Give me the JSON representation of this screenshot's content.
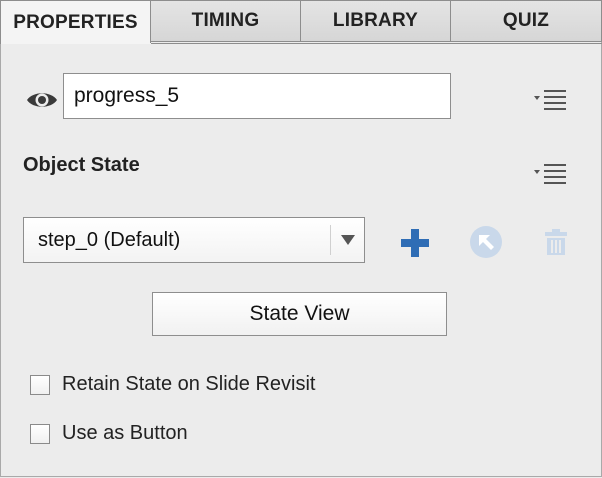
{
  "tabs": [
    {
      "label": "PROPERTIES",
      "active": true
    },
    {
      "label": "TIMING",
      "active": false
    },
    {
      "label": "LIBRARY",
      "active": false
    },
    {
      "label": "QUIZ",
      "active": false
    }
  ],
  "object": {
    "name_value": "progress_5",
    "visibility_icon": "eye-icon"
  },
  "object_state": {
    "section_title": "Object State",
    "selected_state": "step_0 (Default)",
    "add_icon": "plus-icon",
    "edit_icon": "arrow-up-left-circle-icon",
    "delete_icon": "trash-icon",
    "state_view_label": "State View"
  },
  "options": [
    {
      "label": "Retain State on Slide Revisit",
      "checked": false
    },
    {
      "label": "Use as Button",
      "checked": false
    }
  ],
  "colors": {
    "accent_blue": "#2f6db5",
    "disabled_blue": "#c9d8ea",
    "panel_bg": "#ececec"
  }
}
